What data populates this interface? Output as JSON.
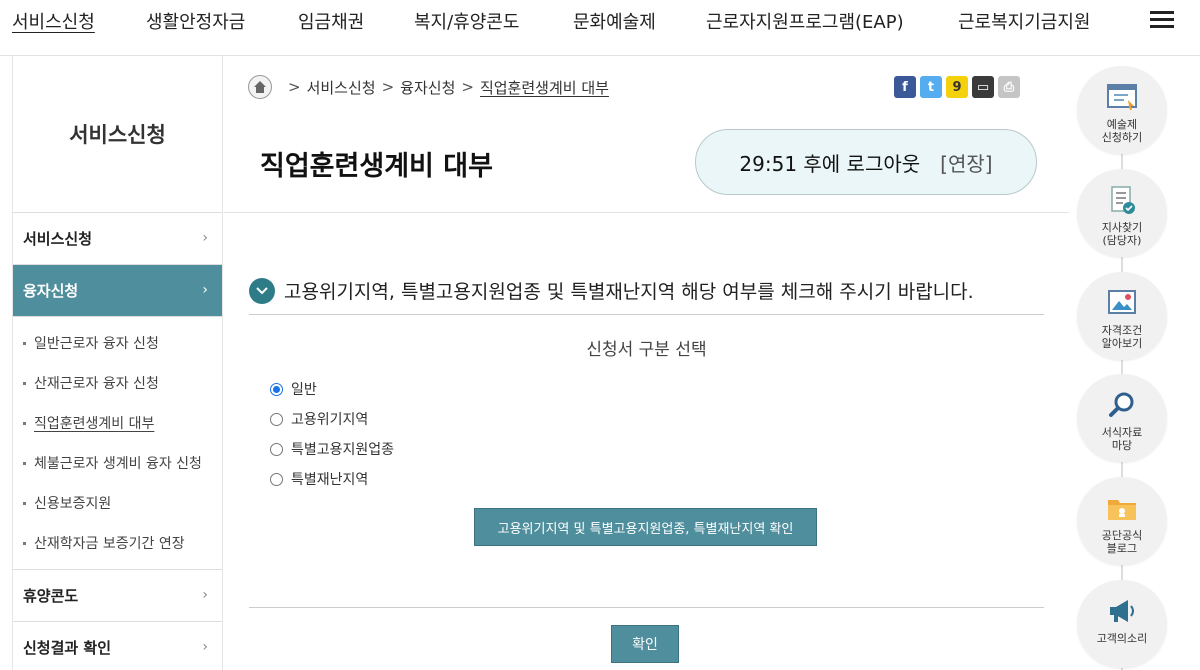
{
  "topnav": {
    "items": [
      "서비스신청",
      "생활안정자금",
      "임금채권",
      "복지/휴양콘도",
      "문화예술제",
      "근로자지원프로그램(EAP)",
      "근로복지기금지원"
    ]
  },
  "sidebar": {
    "title": "서비스신청",
    "menu": [
      {
        "label": "서비스신청"
      },
      {
        "label": "융자신청"
      },
      {
        "label": "휴양콘도"
      },
      {
        "label": "신청결과 확인"
      }
    ],
    "sub_items": [
      "일반근로자 융자 신청",
      "산재근로자 융자 신청",
      "직업훈련생계비 대부",
      "체불근로자 생계비 융자 신청",
      "신용보증지원",
      "산재학자금 보증기간 연장"
    ],
    "chevron": "›"
  },
  "breadcrumb": {
    "items": [
      "서비스신청",
      "융자신청",
      "직업훈련생계비 대부"
    ],
    "sep": ">"
  },
  "share_icons": [
    "facebook-icon",
    "twitter-icon",
    "kakao-icon",
    "band-icon",
    "print-icon"
  ],
  "page": {
    "title": "직업훈련생계비 대부",
    "timer": "29:51 후에 로그아웃",
    "extend_label": "[연장]",
    "notice": "고용위기지역, 특별고용지원업종 및 특별재난지역 해당 여부를 체크해 주시기 바랍니다.",
    "form_title": "신청서 구분 선택",
    "radio_options": [
      "일반",
      "고용위기지역",
      "특별고용지원업종",
      "특별재난지역"
    ],
    "selected_option": "일반",
    "check_button": "고용위기지역 및 특별고용지원업종, 특별재난지역 확인",
    "confirm_button": "확인"
  },
  "quick_menu": [
    {
      "label": "예술제\n신청하기",
      "icon": "form-icon"
    },
    {
      "label": "지사찾기\n(담당자)",
      "icon": "checklist-icon"
    },
    {
      "label": "자격조건\n알아보기",
      "icon": "picture-icon"
    },
    {
      "label": "서식자료\n마당",
      "icon": "search-icon"
    },
    {
      "label": "공단공식\n블로그",
      "icon": "folder-icon"
    },
    {
      "label": "고객의소리",
      "icon": "megaphone-icon"
    }
  ],
  "colors": {
    "accent": "#4f8e9c",
    "check": "#2e7c88"
  }
}
